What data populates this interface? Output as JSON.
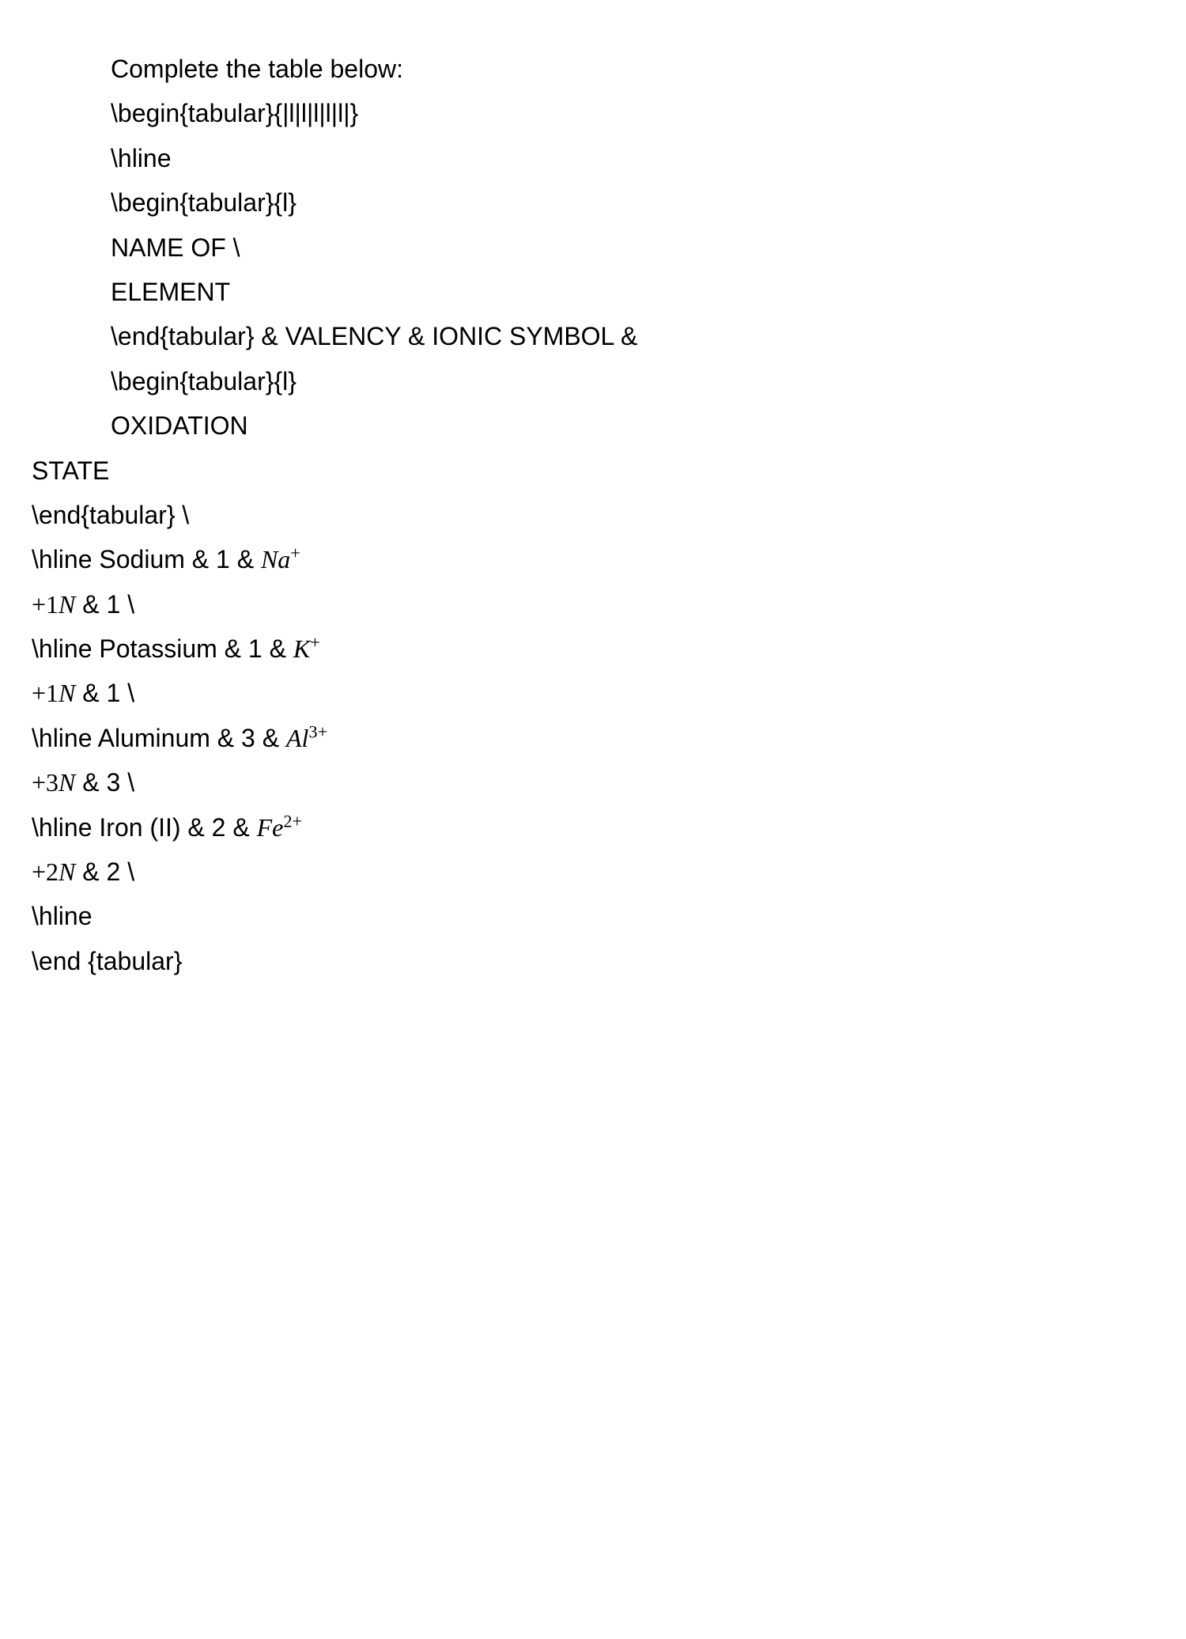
{
  "indented": {
    "l1": "Complete the table below:",
    "l2": "\\begin{tabular}{|l|l|l|l|l|}",
    "l3": "\\hline",
    "l4": "\\begin{tabular}{l}",
    "l5": "NAME OF \\",
    "l6": "ELEMENT",
    "l7": "\\end{tabular} & VALENCY & IONIC SYMBOL &",
    "l8": "\\begin{tabular}{l}",
    "l9": "OXIDATION"
  },
  "outdented": {
    "l10": "STATE",
    "l11": "\\end{tabular} \\",
    "l12_pre": "\\hline Sodium & 1 & ",
    "l12_math_base": "Na",
    "l12_math_sup": "+",
    "l13_math_plus": "+",
    "l13_math_num": "1",
    "l13_math_var": "N",
    "l13_post": " & 1 \\",
    "l14_pre": "\\hline Potassium & 1 & ",
    "l14_math_base": "K",
    "l14_math_sup": "+",
    "l15_math_plus": "+",
    "l15_math_num": "1",
    "l15_math_var": "N",
    "l15_post": " & 1 \\",
    "l16_pre": "\\hline Aluminum & 3 & ",
    "l16_math_base": "Al",
    "l16_math_sup": "3+",
    "l17_math_plus": "+",
    "l17_math_num": "3",
    "l17_math_var": "N",
    "l17_post": " & 3 \\",
    "l18_pre": "\\hline Iron (II) & 2 & ",
    "l18_math_base": "Fe",
    "l18_math_sup": "2+",
    "l19_math_plus": "+",
    "l19_math_num": "2",
    "l19_math_var": "N",
    "l19_post": " & 2 \\",
    "l20": "\\hline",
    "l21": "\\end {tabular}"
  }
}
